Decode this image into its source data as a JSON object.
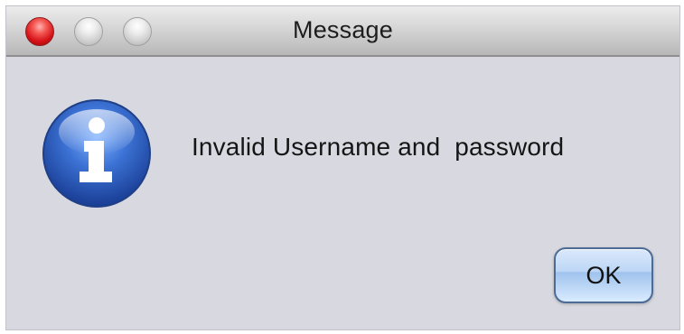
{
  "window": {
    "title": "Message"
  },
  "icons": {
    "close": "close-icon",
    "minimize": "minimize-icon",
    "zoom": "zoom-icon",
    "info": "info-icon"
  },
  "dialog": {
    "message": "Invalid Username and  password",
    "ok_label": "OK"
  },
  "colors": {
    "dialog_background": "#d8d9e0",
    "close_button": "#d7141a",
    "info_blue": "#2f59b8",
    "ok_button_blue": "#bcd6f5"
  }
}
